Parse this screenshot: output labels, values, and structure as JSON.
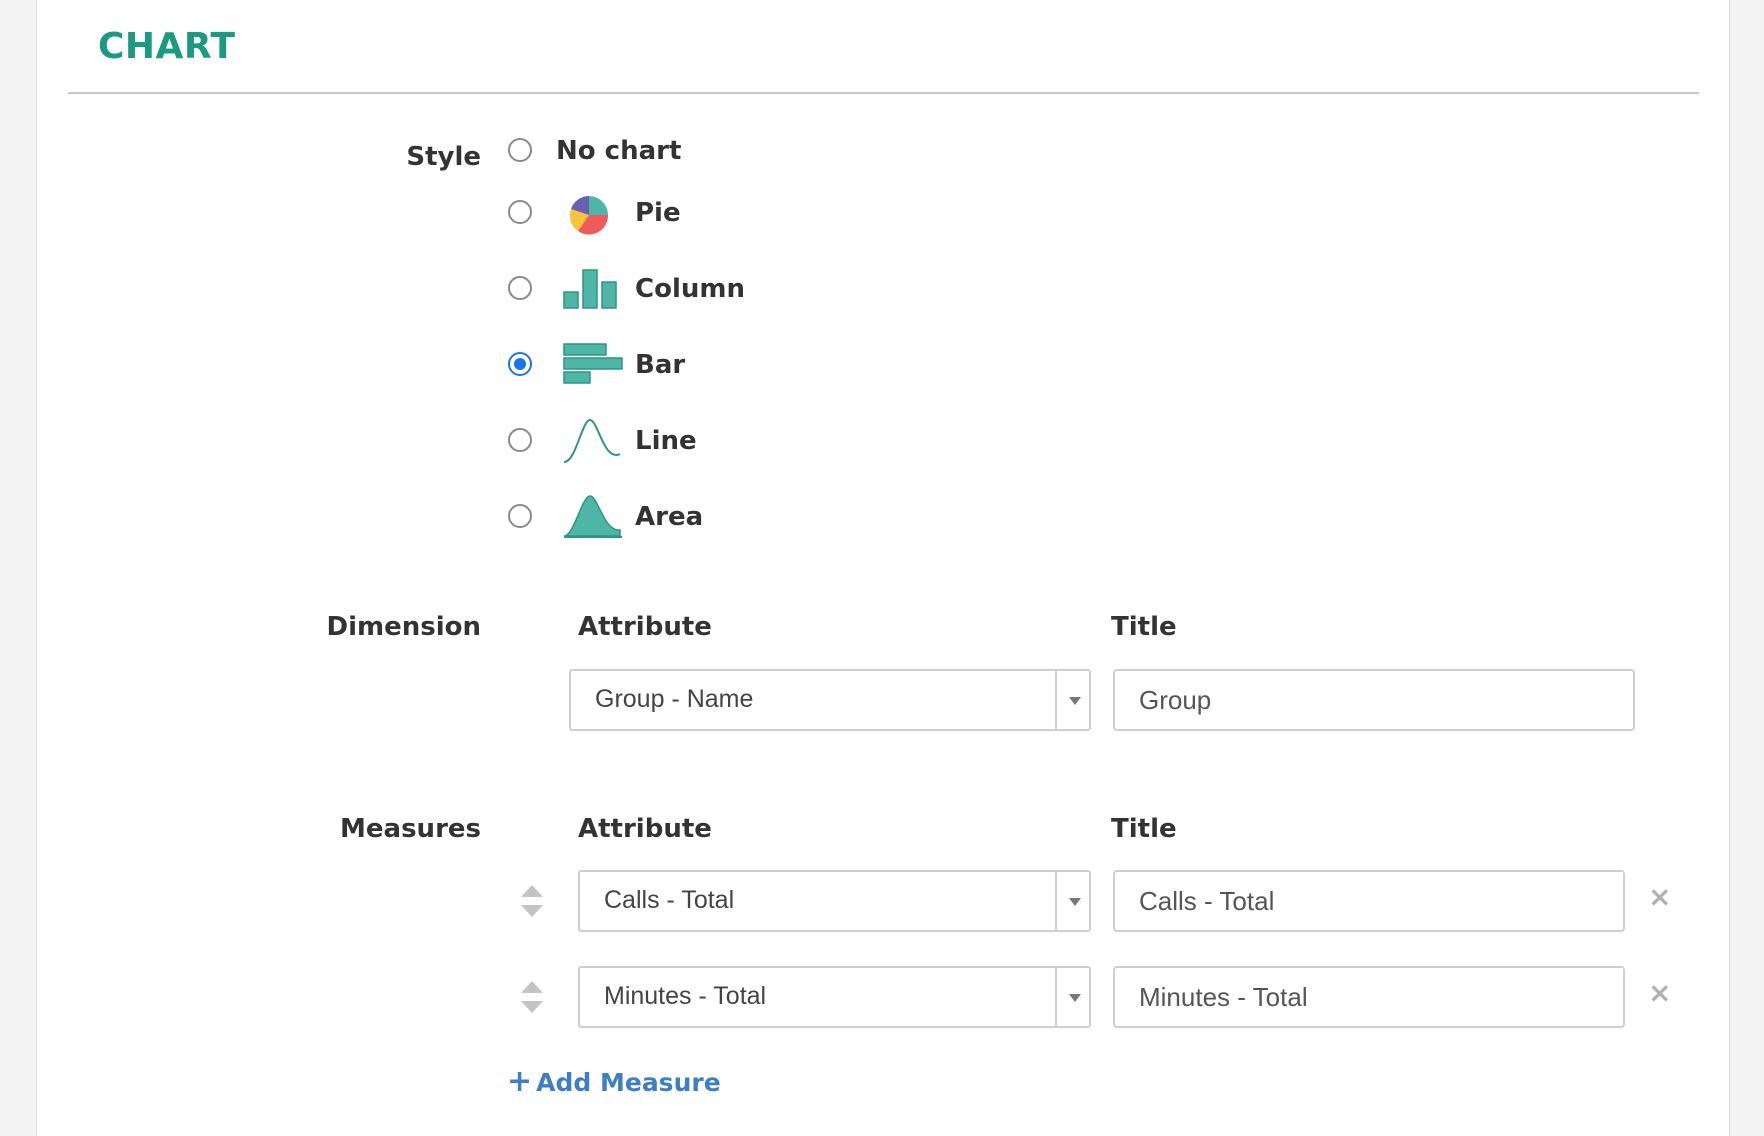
{
  "section": {
    "title": "CHART"
  },
  "style": {
    "label": "Style",
    "options": [
      {
        "label": "No chart",
        "icon": "",
        "checked": false
      },
      {
        "label": "Pie",
        "icon": "pie-chart-icon",
        "checked": false
      },
      {
        "label": "Column",
        "icon": "column-chart-icon",
        "checked": false
      },
      {
        "label": "Bar",
        "icon": "bar-chart-icon",
        "checked": true
      },
      {
        "label": "Line",
        "icon": "line-chart-icon",
        "checked": false
      },
      {
        "label": "Area",
        "icon": "area-chart-icon",
        "checked": false
      }
    ]
  },
  "dimension": {
    "label": "Dimension",
    "attribute_header": "Attribute",
    "title_header": "Title",
    "attribute_value": "Group - Name",
    "title_value": "Group"
  },
  "measures": {
    "label": "Measures",
    "attribute_header": "Attribute",
    "title_header": "Title",
    "rows": [
      {
        "attribute_value": "Calls - Total",
        "title_value": "Calls - Total"
      },
      {
        "attribute_value": "Minutes - Total",
        "title_value": "Minutes - Total"
      }
    ],
    "remove_symbol": "×",
    "add_label": "Add Measure",
    "add_symbol": "+"
  },
  "colors": {
    "accent": "#1a9a7f",
    "chart_icon_fill": "#4db6a6",
    "radio_checked": "#1a73e8",
    "link": "#3c7fc4"
  }
}
